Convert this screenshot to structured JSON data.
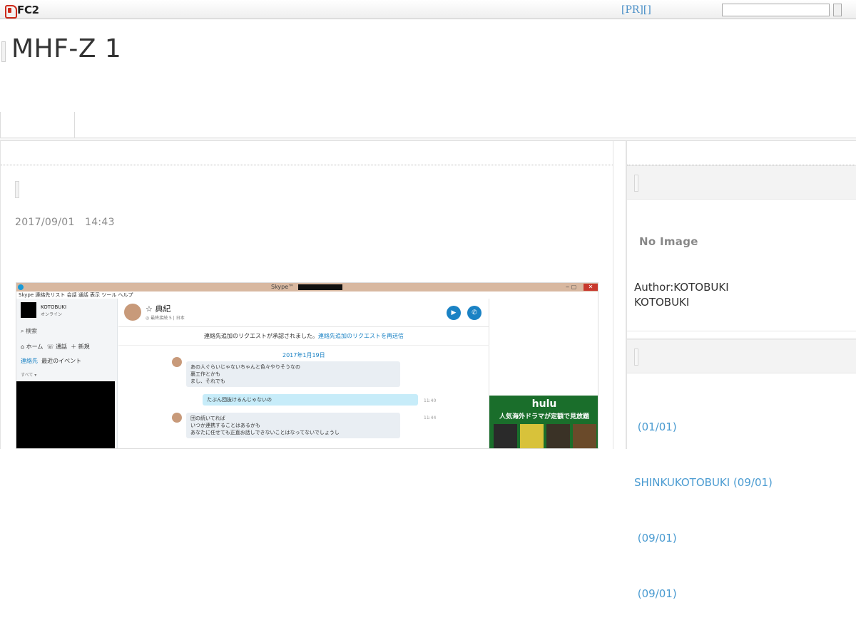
{
  "fc2bar": {
    "logo_text": "FC2",
    "pr_link": "[PR][]",
    "search_value": ""
  },
  "header": {
    "blog_title": "MHF-Z 1"
  },
  "entry": {
    "date": "2017/09/01　14:43"
  },
  "screenshot": {
    "window_title": "Skype™",
    "window_controls": "‒ ▢",
    "close": "✕",
    "menu": "Skype  連絡先リスト  会話  通話  表示  ツール  ヘルプ",
    "side_name": "KOTOBUKI",
    "side_status": "オンライン",
    "side_search": "⌕ 検索",
    "side_nav": "⌂ ホーム  ☏ 通話  ＋ 新規",
    "side_tab_active": "連絡先",
    "side_tab_other": "  最近のイベント",
    "side_sub": "すべて ▾",
    "chat_name": "☆ 典紀",
    "chat_sub": "◎ 最終接続 5 | 日本",
    "call_video": "▶",
    "call_audio": "✆",
    "notice_text": "連絡先追加のリクエストが承認されました。",
    "notice_link": "連絡先追加のリクエストを再送信",
    "chat_date": "2017年1月19日",
    "msg1": "あの人ぐらいじゃないちゃんと色々やりそうなの\n裏工作とかも\nまし、それでも",
    "msg2": "たぶん団抜けるんじゃないの",
    "msg2_time": "11:40",
    "msg3": "団の続いてれば\nいつか連携することはあるかも\nあなたに任せても正直お話しできないことはなってないでしょうし",
    "msg3_time": "11:44",
    "hulu_logo": "hulu",
    "hulu_sub": "人気海外ドラマが定額で見放題"
  },
  "sidebar": {
    "no_image": "No Image",
    "author_line1": "Author:KOTOBUKI",
    "author_line2": "KOTOBUKI",
    "entries": [
      " (01/01)",
      "SHINKUKOTOBUKI (09/01)",
      " (09/01)",
      " (09/01)"
    ]
  },
  "colors": {
    "link": "#4a9bd1",
    "fc2_red": "#cc2a1a",
    "hulu_green": "#1a6e2b"
  }
}
